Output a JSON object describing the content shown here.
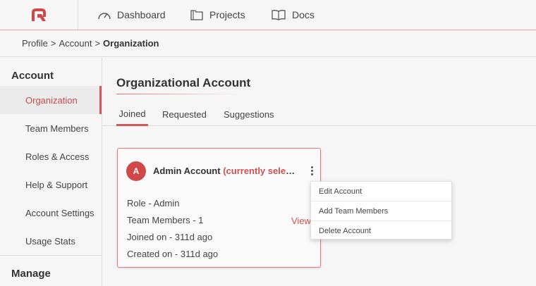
{
  "brand": {
    "accent": "#d05050",
    "logo_letter": "Q"
  },
  "topnav": {
    "items": [
      {
        "label": "Dashboard",
        "icon": "gauge-icon"
      },
      {
        "label": "Projects",
        "icon": "folder-icon"
      },
      {
        "label": "Docs",
        "icon": "book-icon"
      }
    ]
  },
  "breadcrumb": {
    "items": [
      "Profile",
      "Account"
    ],
    "separator": ">",
    "current": "Organization"
  },
  "sidebar": {
    "sections": [
      {
        "heading": "Account",
        "items": [
          "Organization",
          "Team Members",
          "Roles & Access",
          "Help & Support",
          "Account Settings",
          "Usage Stats"
        ],
        "active": "Organization"
      },
      {
        "heading": "Manage"
      }
    ]
  },
  "main": {
    "title": "Organizational Account",
    "tabs": [
      {
        "label": "Joined",
        "active": true
      },
      {
        "label": "Requested",
        "active": false
      },
      {
        "label": "Suggestions",
        "active": false
      }
    ],
    "card": {
      "avatar_letter": "A",
      "name": "Admin Account",
      "selected_tag": "(currently selected)",
      "role": "Role -  Admin",
      "team_members": "Team Members -  1",
      "view_label": "View",
      "joined": "Joined on - 311d ago",
      "created": "Created on - 311d ago"
    },
    "menu": {
      "items": [
        "Edit Account",
        "Add Team Members",
        "Delete Account"
      ]
    }
  }
}
